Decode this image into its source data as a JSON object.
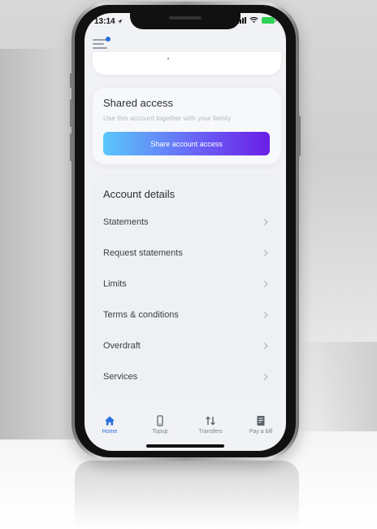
{
  "status_bar": {
    "time": "13:14"
  },
  "shared_access": {
    "title": "Shared access",
    "subtitle": "Use this account together with your family",
    "button_label": "Share account access"
  },
  "account_details": {
    "title": "Account details",
    "items": [
      {
        "label": "Statements"
      },
      {
        "label": "Request statements"
      },
      {
        "label": "Limits"
      },
      {
        "label": "Terms & conditions"
      },
      {
        "label": "Overdraft"
      },
      {
        "label": "Services"
      }
    ]
  },
  "tab_bar": {
    "tabs": [
      {
        "label": "Home",
        "icon": "home-icon",
        "active": true
      },
      {
        "label": "Topup",
        "icon": "phone-icon",
        "active": false
      },
      {
        "label": "Transfers",
        "icon": "transfer-arrows-icon",
        "active": false
      },
      {
        "label": "Pay a bill",
        "icon": "bill-icon",
        "active": false
      }
    ]
  },
  "colors": {
    "accent": "#2a6fdb",
    "button_gradient_start": "#5ac8fa",
    "button_gradient_end": "#6a1ee6",
    "battery": "#30d158"
  }
}
